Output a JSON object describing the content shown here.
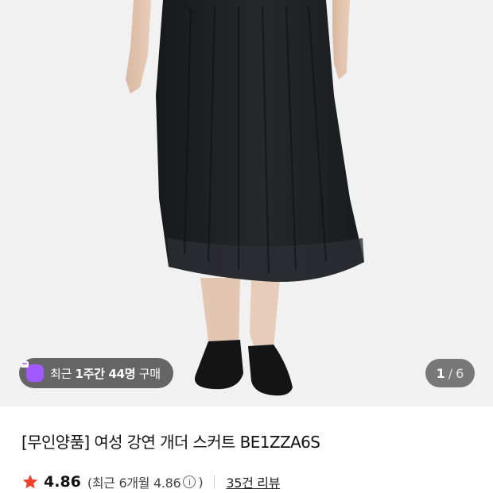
{
  "gallery": {
    "image_description_icon": "product-photo",
    "badge": {
      "prefix": "최근 ",
      "period": "1주간",
      "count": " 44명",
      "suffix": " 구매"
    },
    "indicator": {
      "current": "1",
      "separator": "/",
      "total": "6"
    }
  },
  "product": {
    "title": "[무인양품] 여성 강연 개더 스커트 BE1ZZA6S",
    "rating": "4.86",
    "recent_rating_open": "(최근 6개월 4.86",
    "recent_rating_close": ")",
    "info_glyph": "i",
    "review_count": "35건 리뷰"
  },
  "colors": {
    "star": "#f0412a",
    "badge_icon": "#a259ff",
    "skirt": "#1c1d20"
  }
}
